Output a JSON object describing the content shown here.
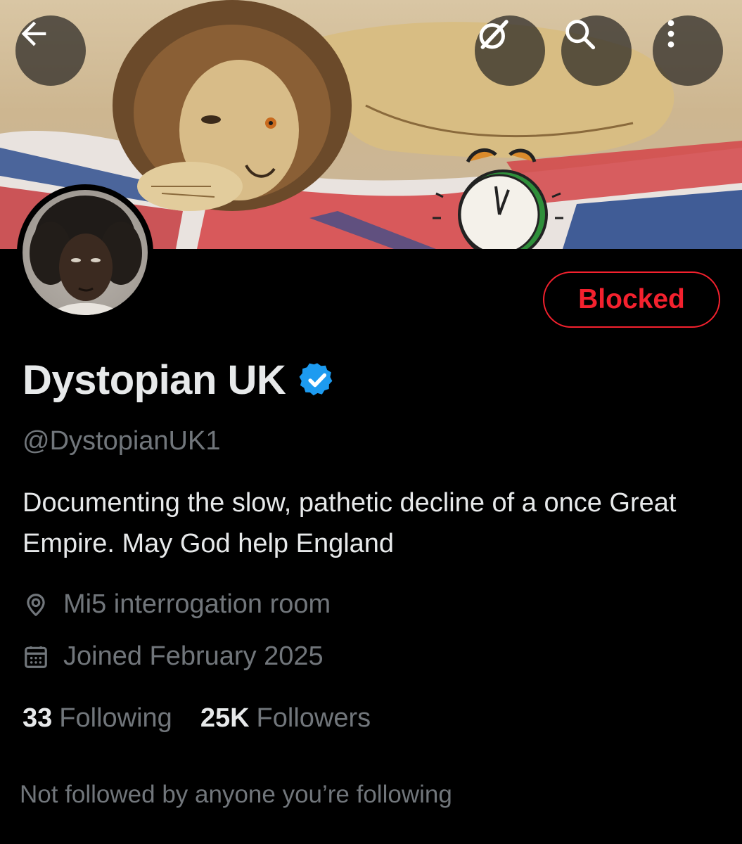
{
  "header": {
    "back_icon": "arrow-left-icon",
    "grok_icon": "grok-slash-icon",
    "search_icon": "search-icon",
    "more_icon": "more-vertical-icon"
  },
  "banner": {
    "description_icon": "lion-union-jack-alarm-clock-banner"
  },
  "profile": {
    "display_name": "Dystopian UK",
    "verified_icon": "verified-badge-icon",
    "verified_color": "#1d9bf0",
    "handle": "@DystopianUK1",
    "bio": "Documenting the slow, pathetic decline of a once Great Empire. May God help England",
    "location_icon": "location-pin-icon",
    "location": "Mi5 interrogation room",
    "joined_icon": "calendar-icon",
    "joined": "Joined February 2025"
  },
  "actions": {
    "blocked_label": "Blocked",
    "blocked_color": "#f4212e"
  },
  "stats": {
    "following_count": "33",
    "following_label": "Following",
    "followers_count": "25K",
    "followers_label": "Followers"
  },
  "social_context": "Not followed by anyone you’re following"
}
